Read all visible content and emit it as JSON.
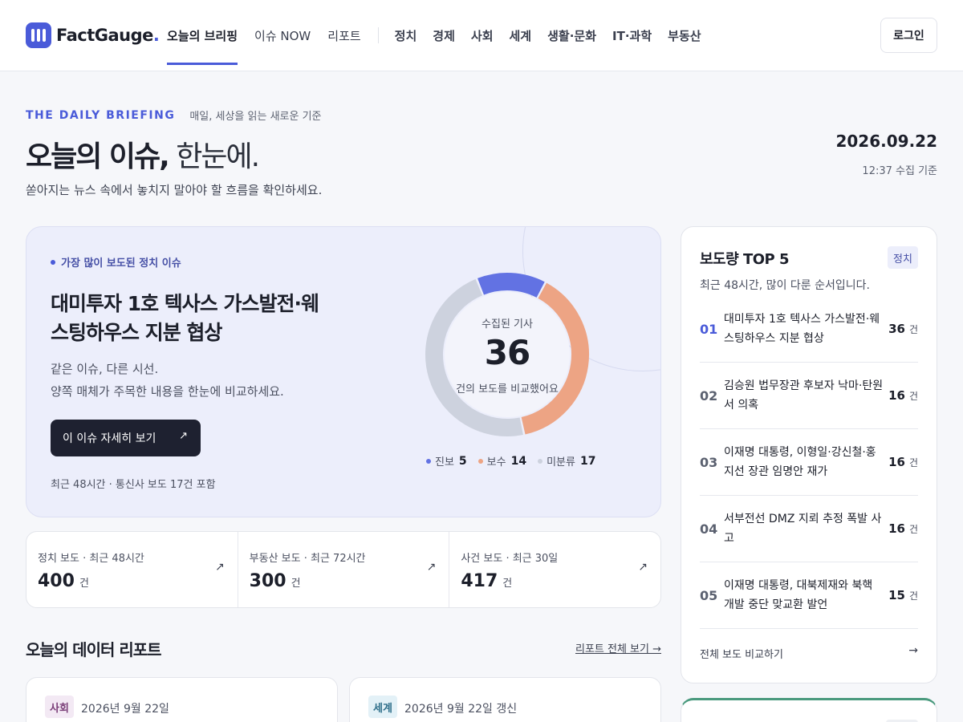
{
  "header": {
    "logo_text": "FactGauge",
    "logo_dot": ".",
    "nav_main": [
      "오늘의 브리핑",
      "이슈 NOW",
      "리포트"
    ],
    "nav_categories": [
      "정치",
      "경제",
      "사회",
      "세계",
      "생활·문화",
      "IT·과학",
      "부동산"
    ],
    "login_label": "로그인"
  },
  "hero": {
    "eyebrow": "THE DAILY BRIEFING",
    "eyebrow_sub": "매일, 세상을 읽는 새로운 기준",
    "title_bold": "오늘의 이슈,",
    "title_light": " 한눈에.",
    "description": "쏟아지는 뉴스 속에서 놓치지 말아야 할 흐름을 확인하세요.",
    "date": "2026.09.22",
    "time": "12:37 수집 기준"
  },
  "feature": {
    "label": "가장 많이 보도된 정치 이슈",
    "title": "대미투자 1호 텍사스 가스발전·웨스팅하우스 지분 협상",
    "desc1": "같은 이슈, 다른 시선.",
    "desc2": "양쪽 매체가 주목한 내용을 한눈에 비교하세요.",
    "button_label": "이 이슈 자세히 보기",
    "button_arrow": "↗",
    "footnote": "최근 48시간 · 통신사 보도 17건 포함",
    "donut_caption": "수집된 기사",
    "donut_total": "36",
    "donut_sub": "건의 보도를 비교했어요",
    "segments": [
      {
        "name": "진보",
        "value": 5,
        "color": "#6272e3"
      },
      {
        "name": "보수",
        "value": 14,
        "color": "#eda484"
      },
      {
        "name": "미분류",
        "value": 17,
        "color": "#cdd2de"
      }
    ],
    "legend": [
      {
        "label": "진보",
        "value": "5",
        "color": "#6272e3"
      },
      {
        "label": "보수",
        "value": "14",
        "color": "#eda484"
      },
      {
        "label": "미분류",
        "value": "17",
        "color": "#cdd2de"
      }
    ]
  },
  "stats": [
    {
      "label": "정치 보도 · 최근 48시간",
      "value": "400",
      "unit": "건"
    },
    {
      "label": "부동산 보도 · 최근 72시간",
      "value": "300",
      "unit": "건"
    },
    {
      "label": "사건 보도 · 최근 30일",
      "value": "417",
      "unit": "건"
    }
  ],
  "stats_arrow": "↗",
  "report": {
    "title": "오늘의 데이터 리포트",
    "link": "리포트 전체 보기 →",
    "cards": [
      {
        "chip": "사회",
        "date": "2026년 9월 22일"
      },
      {
        "chip": "세계",
        "date": "2026년 9월 22일 갱신"
      }
    ]
  },
  "top5": {
    "title": "보도량 TOP 5",
    "chip": "정치",
    "subtitle": "최근 48시간, 많이 다룬 순서입니다.",
    "unit": "건",
    "items": [
      {
        "rank": "01",
        "text": "대미투자 1호 텍사스 가스발전·웨스팅하우스 지분 협상",
        "count": "36"
      },
      {
        "rank": "02",
        "text": "김승원 법무장관 후보자 낙마·탄원서 의혹",
        "count": "16"
      },
      {
        "rank": "03",
        "text": "이재명 대통령, 이형일·강신철·홍지선 장관 임명안 재가",
        "count": "16"
      },
      {
        "rank": "04",
        "text": "서부전선 DMZ 지뢰 추정 폭발 사고",
        "count": "16"
      },
      {
        "rank": "05",
        "text": "이재명 대통령, 대북제재와 북핵 개발 중단 맞교환 발언",
        "count": "15"
      }
    ],
    "footer": "전체 보도 비교하기",
    "footer_arrow": "→"
  }
}
